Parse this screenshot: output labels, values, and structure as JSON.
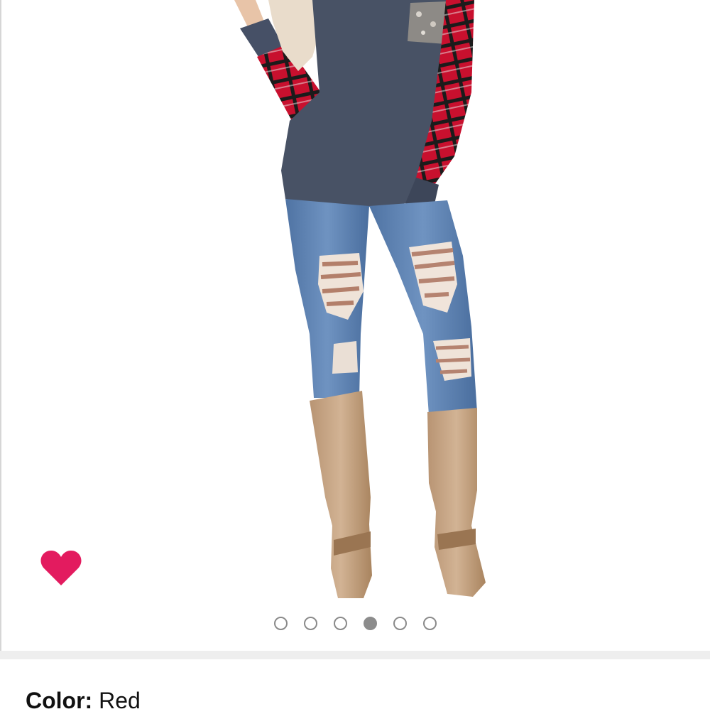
{
  "carousel": {
    "dots": [
      {
        "active": false
      },
      {
        "active": false
      },
      {
        "active": false
      },
      {
        "active": true
      },
      {
        "active": false
      },
      {
        "active": false
      }
    ]
  },
  "favorite": {
    "icon": "heart-icon",
    "color": "#e31b5f"
  },
  "variant": {
    "color_label": "Color:",
    "color_value": "Red"
  }
}
